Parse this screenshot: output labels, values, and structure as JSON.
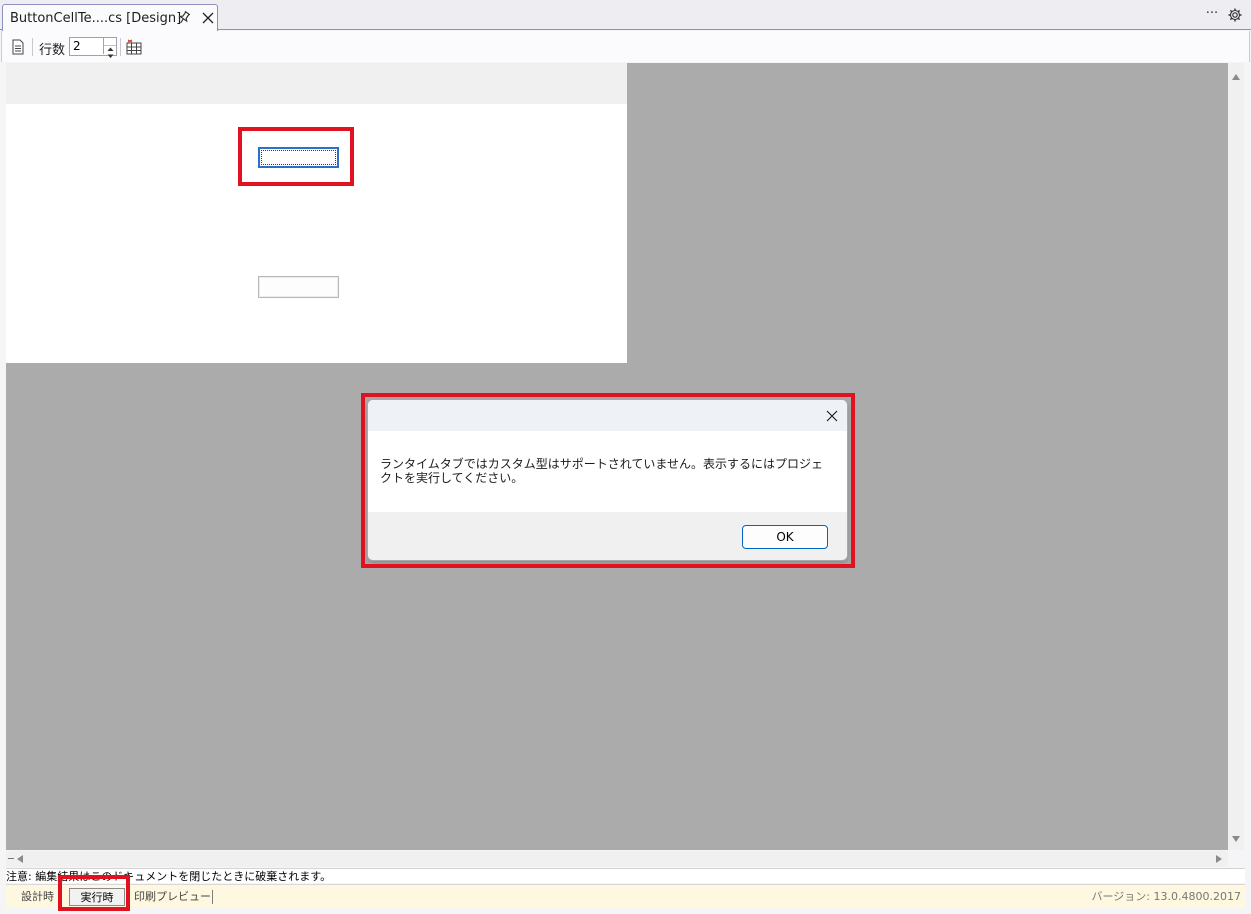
{
  "tab": {
    "title": "ButtonCellTe....cs [Design]",
    "pin_icon": "pin-icon",
    "close_icon": "close-icon"
  },
  "tabbar_right": {
    "more": "···",
    "settings_icon": "gear-icon"
  },
  "toolbar": {
    "rows_label": "行数",
    "rows_value": "2"
  },
  "dialog": {
    "message": "ランタイムタブではカスタム型はサポートされていません。表示するにはプロジェクトを実行してください。",
    "ok_label": "OK"
  },
  "note": "注意: 編集結果はこのドキュメントを閉じたときに破棄されます。",
  "bottom_tabs": {
    "design": "設計時",
    "runtime": "実行時",
    "print_preview": "印刷プレビュー"
  },
  "version": "バージョン: 13.0.4800.2017",
  "colors": {
    "highlight": "#e0121f",
    "canvas_gray": "#ababab",
    "accent_blue": "#0067c0"
  }
}
